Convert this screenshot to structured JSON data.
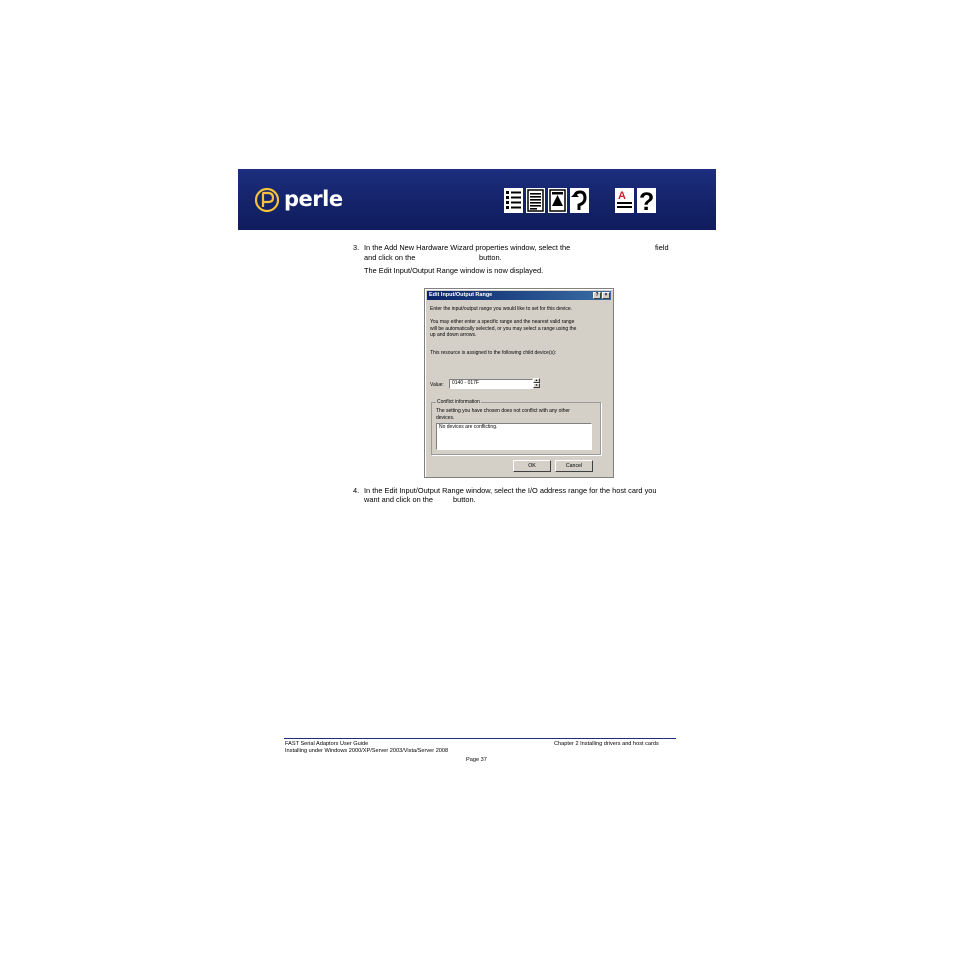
{
  "header": {
    "logo_text": "perle",
    "nav_icons": [
      "contents-icon",
      "index-icon",
      "top-icon",
      "back-icon",
      "glossary-icon",
      "help-icon"
    ],
    "nav_letter": "A",
    "nav_question": "?",
    "colors": {
      "banner": "#14236a"
    }
  },
  "body": {
    "step3": {
      "number": "3.",
      "line1": "In the Add New Hardware Wizard properties window, select the",
      "line1_end": "field",
      "line2a": "and click on the",
      "line2b": "button.",
      "line3": "The Edit Input/Output Range window is now displayed."
    },
    "step4": {
      "number": "4.",
      "line1": "In the Edit Input/Output Range window, select the I/O address range for the host card you",
      "line2a": "want and click on the",
      "line2b": "button."
    }
  },
  "dialog": {
    "title": "Edit Input/Output Range",
    "help_btn": "?",
    "close_btn": "×",
    "intro": "Enter the input/output range you would like to set for this device.",
    "hint": [
      "You may either enter a specific range and the nearest valid range",
      "will be automatically selected, or you may select a range using the",
      "up and down arrows."
    ],
    "assigned": "This resource is assigned to the following child device(s):",
    "value_label": "Value:",
    "value": "0140 - 017F",
    "conflict_label": "Conflict information",
    "conflict_text": [
      "The setting you have chosen does not conflict with any other",
      "devices."
    ],
    "conflict_list": "No devices are conflicting.",
    "ok": "OK",
    "cancel": "Cancel"
  },
  "footer": {
    "left1": "FAST Serial Adaptors User Guide",
    "left2": "Installing under Windows 2000/XP/Server 2003/Vista/Server 2008",
    "right1": "Chapter 2 Installing drivers and host cards",
    "page": "Page 37"
  }
}
